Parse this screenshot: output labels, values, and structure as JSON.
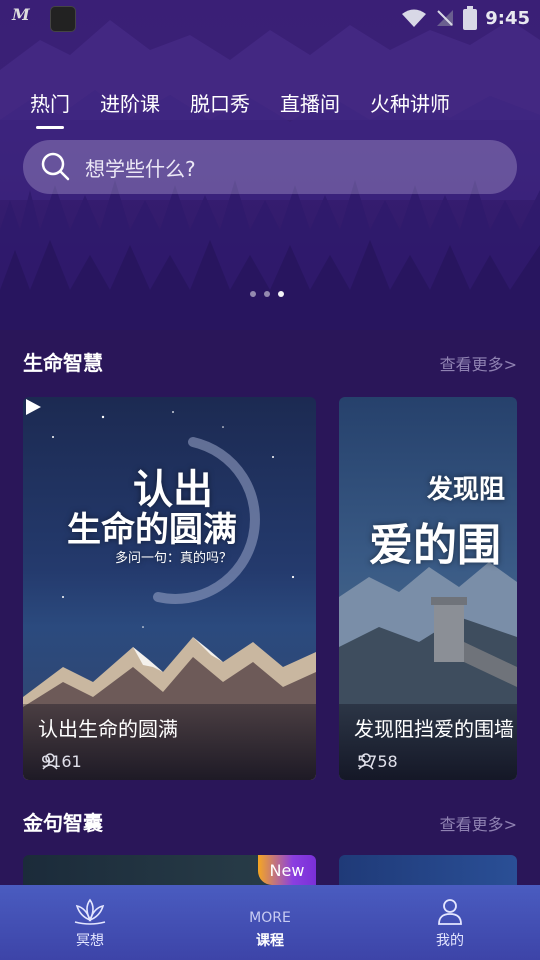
{
  "status_bar": {
    "logo_text": "M",
    "time": "9:45",
    "icons": [
      "wifi-icon",
      "signal-icon",
      "battery-icon"
    ]
  },
  "tabs": [
    {
      "label": "热门",
      "active": true
    },
    {
      "label": "进阶课",
      "active": false
    },
    {
      "label": "脱口秀",
      "active": false
    },
    {
      "label": "直播间",
      "active": false
    },
    {
      "label": "火种讲师",
      "active": false
    }
  ],
  "search": {
    "placeholder": "想学些什么?"
  },
  "banner": {
    "page_count": 3,
    "active_index": 2
  },
  "sections": [
    {
      "title": "生命智慧",
      "more_label": "查看更多>",
      "cards": [
        {
          "title": "认出生命的圆满",
          "count": "9161",
          "poster_line1": "认出",
          "poster_line2": "生命的圆满",
          "poster_sub": "多问一句：真的吗？"
        },
        {
          "title": "发现阻挡爱的围墙",
          "count": "5758",
          "poster_line1": "发现阻",
          "poster_line2": "爱的围"
        }
      ]
    },
    {
      "title": "金句智囊",
      "more_label": "查看更多>",
      "badge": "New"
    }
  ],
  "bottom_nav": [
    {
      "label": "冥想",
      "icon": "lotus-icon",
      "active": false
    },
    {
      "label": "课程",
      "icon": "more-icon",
      "icon_text": "MORE",
      "active": true
    },
    {
      "label": "我的",
      "icon": "user-icon",
      "active": false
    }
  ],
  "colors": {
    "background": "#2a1659",
    "hero": "#3a1f76",
    "more_link": "#8f82b2",
    "nav_bar": "#4a5cc0",
    "new_badge_start": "#f5a623",
    "new_badge_end": "#7a2fd8"
  }
}
